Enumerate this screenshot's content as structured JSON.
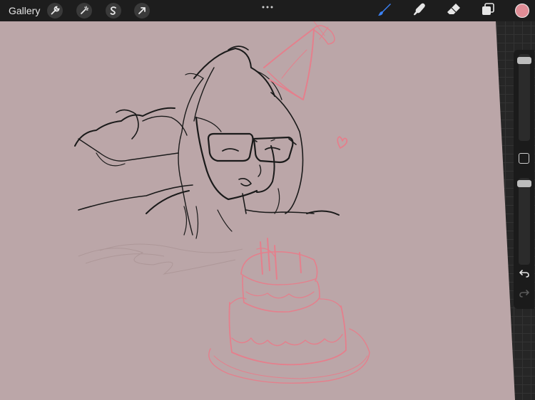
{
  "toolbar": {
    "gallery_label": "Gallery",
    "left_tools": [
      {
        "name": "actions",
        "icon": "wrench-icon"
      },
      {
        "name": "adjustments",
        "icon": "magic-wand-icon"
      },
      {
        "name": "selection",
        "icon": "selection-s-icon"
      },
      {
        "name": "transform",
        "icon": "arrow-cursor-icon"
      }
    ],
    "more_icon": "ellipsis-icon",
    "right_tools": [
      {
        "name": "brush",
        "icon": "brush-icon",
        "active": true
      },
      {
        "name": "smudge",
        "icon": "smudge-finger-icon",
        "active": false
      },
      {
        "name": "eraser",
        "icon": "eraser-icon",
        "active": false
      },
      {
        "name": "layers",
        "icon": "layers-icon",
        "active": false
      }
    ],
    "current_color": "#e08d96"
  },
  "sidebar": {
    "brush_size_level": 0.04,
    "opacity_level": 0.03,
    "modify_icon": "square-modify-icon",
    "undo_icon": "undo-arrow-icon",
    "redo_icon": "redo-arrow-icon"
  },
  "colors": {
    "canvas": "#bba6a8",
    "active_tool": "#3b82f6",
    "sketch_ink": "#1a1a1a",
    "sketch_pink": "#e57f8c"
  }
}
